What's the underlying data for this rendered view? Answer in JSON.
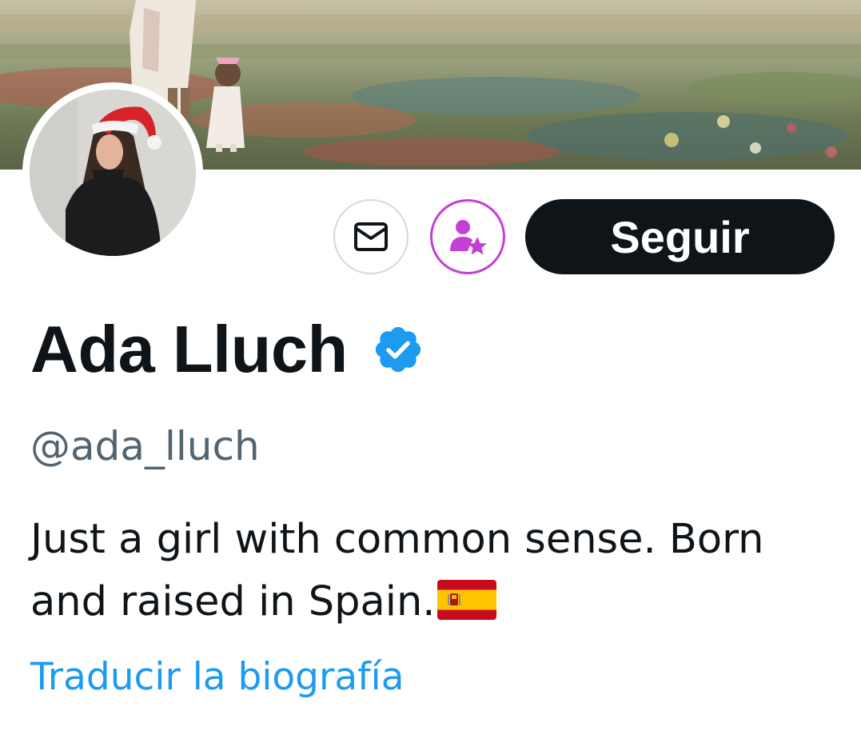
{
  "profile": {
    "display_name": "Ada Lluch",
    "handle": "@ada_lluch",
    "verified": true,
    "bio_text": "Just a girl with common sense. Born and raised in Spain.",
    "bio_emoji": "spain-flag",
    "translate_label": "Traducir la biografía"
  },
  "actions": {
    "message_icon": "envelope-icon",
    "subscribe_icon": "person-star-icon",
    "follow_label": "Seguir"
  },
  "colors": {
    "text_primary": "#0f1419",
    "text_secondary": "#536471",
    "link": "#1d9bf0",
    "verified_badge": "#1d9bf0",
    "follow_button_bg": "#0f1419",
    "subscribe_accent": "#c43fd6"
  }
}
